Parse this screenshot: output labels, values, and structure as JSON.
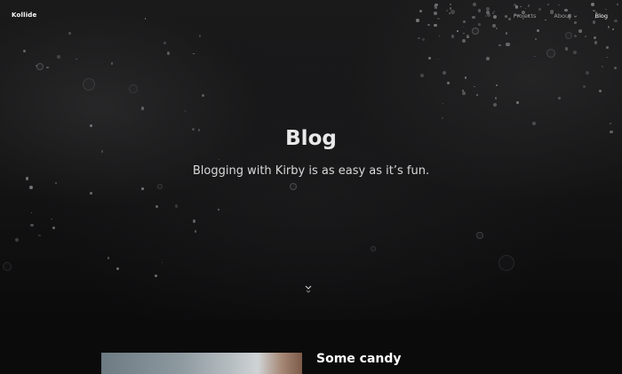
{
  "site": {
    "logo": "Kollide"
  },
  "nav": {
    "items": [
      {
        "label": "Projects"
      },
      {
        "label": "About",
        "has_dropdown": true
      },
      {
        "label": "Blog",
        "active": true
      }
    ]
  },
  "hero": {
    "title": "Blog",
    "subtitle": "Blogging with Kirby is as easy as it’s fun.",
    "scroll_icon": "chevron-down-icon"
  },
  "posts": [
    {
      "title": "Some candy"
    }
  ],
  "colors": {
    "background": "#0b0b0c",
    "text": "#e9e9ea",
    "nav_inactive": "#9a9a9c",
    "nav_active": "#ffffff"
  }
}
